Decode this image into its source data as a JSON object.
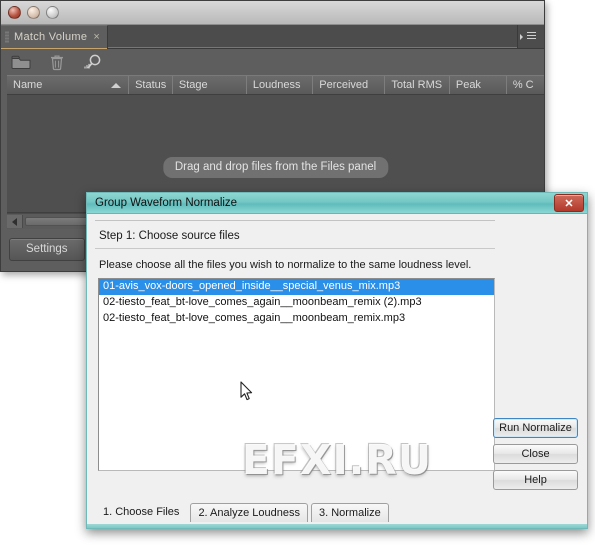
{
  "host_window": {
    "mac_buttons": [
      "close",
      "minimize",
      "zoom"
    ],
    "panel": {
      "tab_label": "Match Volume",
      "tab_close_glyph": "×",
      "menu_icon": "panel-menu-icon"
    },
    "toolbar": {
      "icons": [
        "folder-icon",
        "trash-icon",
        "scan-loudness-icon"
      ]
    },
    "table": {
      "columns": [
        {
          "label": "Name",
          "width": 128,
          "sorted": true
        },
        {
          "label": "Status",
          "width": 46
        },
        {
          "label": "Stage",
          "width": 78
        },
        {
          "label": "Loudness",
          "width": 70
        },
        {
          "label": "Perceived",
          "width": 76
        },
        {
          "label": "Total RMS",
          "width": 68
        },
        {
          "label": "Peak",
          "width": 60
        },
        {
          "label": "% C",
          "width": 40
        }
      ],
      "empty_hint": "Drag and drop files from the Files panel",
      "rows": []
    },
    "settings_button_label": "Settings"
  },
  "dialog": {
    "title": "Group Waveform Normalize",
    "close_glyph": "✕",
    "step_label": "Step 1:  Choose source files",
    "instruction": "Please choose all the files you wish to normalize to the same loudness level.",
    "files": [
      {
        "name": "01-avis_vox-doors_opened_inside__special_venus_mix.mp3",
        "selected": true
      },
      {
        "name": "02-tiesto_feat_bt-love_comes_again__moonbeam_remix (2).mp3",
        "selected": false
      },
      {
        "name": "02-tiesto_feat_bt-love_comes_again__moonbeam_remix.mp3",
        "selected": false
      }
    ],
    "buttons": [
      {
        "label": "Run Normalize",
        "default": true
      },
      {
        "label": "Close",
        "default": false
      },
      {
        "label": "Help",
        "default": false
      }
    ],
    "tabs": [
      {
        "label": "1. Choose Files",
        "active": true
      },
      {
        "label": "2. Analyze Loudness",
        "active": false
      },
      {
        "label": "3. Normalize",
        "active": false
      }
    ]
  },
  "watermark": {
    "text": "EFXI.RU"
  },
  "colors": {
    "panel_bg": "#5e5e5e",
    "dialog_title_teal": "#72c7c4",
    "selection_blue": "#2a8fe8",
    "close_button_red": "#b1392b",
    "tab_underline": "#c8a46a"
  }
}
